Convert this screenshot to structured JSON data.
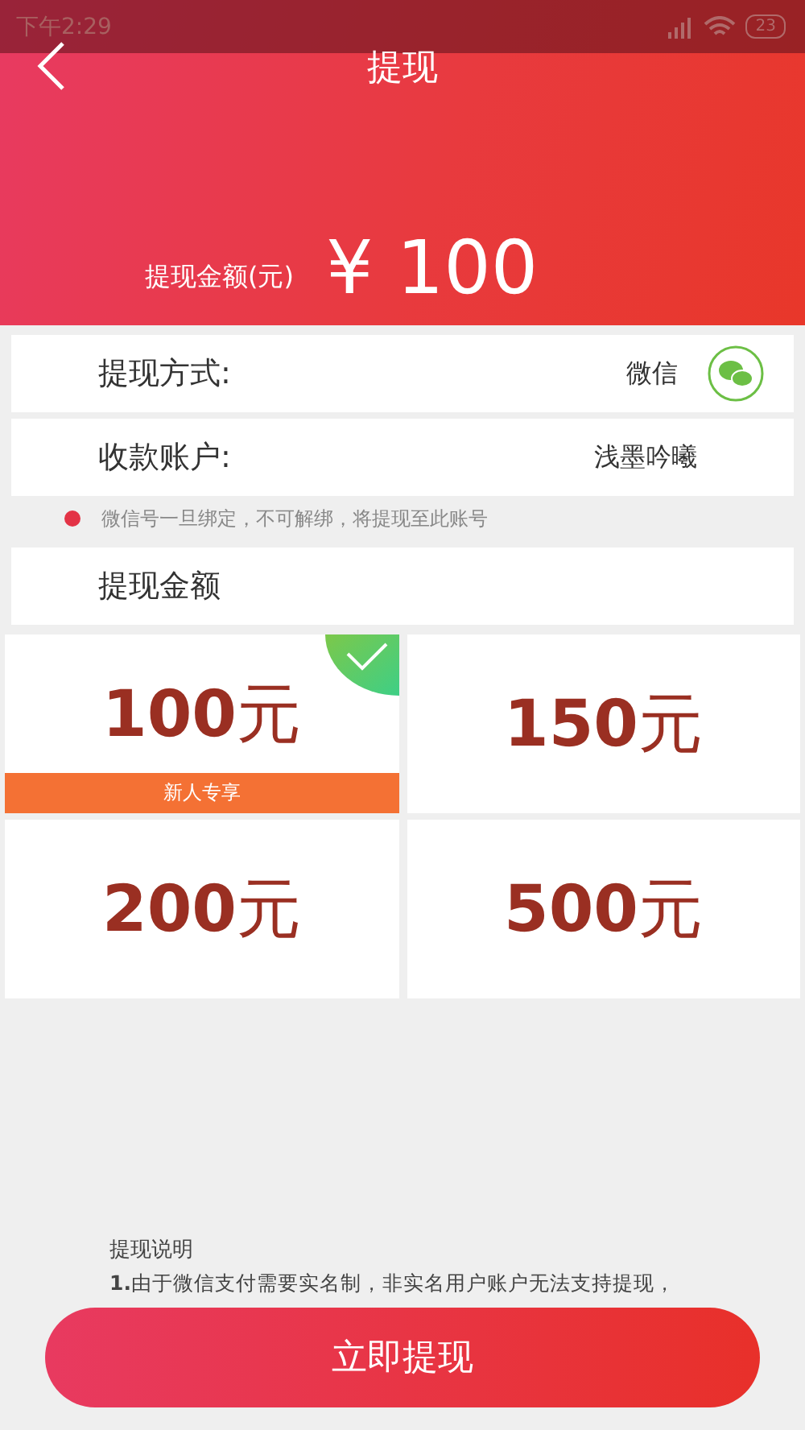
{
  "status_bar": {
    "time": "下午2:29",
    "battery": "23"
  },
  "header": {
    "title": "提现",
    "amount_label": "提现金额(元)",
    "amount": "¥ 100"
  },
  "rows": [
    {
      "label": "提现方式:",
      "value": "微信",
      "kind": "wechat"
    },
    {
      "label": "收款账户:",
      "value": "浅墨吟曦",
      "kind": "plain"
    }
  ],
  "notice": "微信号一旦绑定，不可解绑，将提现至此账号",
  "amount_section": {
    "title": "提现金额"
  },
  "options": [
    {
      "label": "**100**元",
      "selected": true,
      "badge": "新人专享"
    },
    {
      "label": "**150**元",
      "selected": false
    },
    {
      "label": "**200**元",
      "selected": false
    },
    {
      "label": "**500**元",
      "selected": false
    }
  ],
  "notes": {
    "title": "提现说明",
    "lines": [
      "**1.**由于微信支付需要实名制，非实名用户账户无法支持提现，"
    ]
  },
  "submit": "立即提现"
}
